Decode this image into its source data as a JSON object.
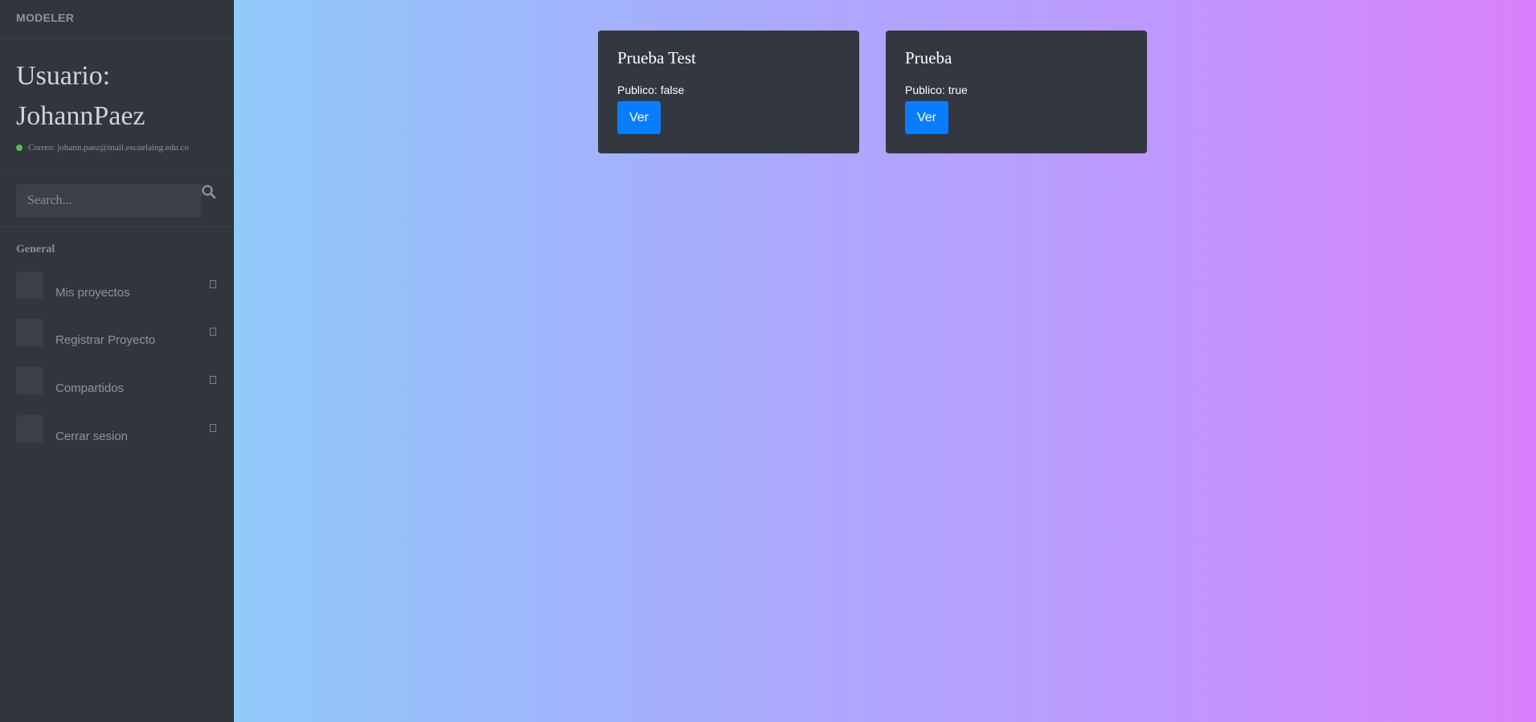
{
  "sidebar": {
    "brand": "MODELER",
    "user_title": "Usuario: JohannPaez",
    "email": "Correo: johann.paez@mail.escuelaing.edu.co",
    "search_placeholder": "Search...",
    "section_label": "General",
    "items": [
      {
        "label": "Mis proyectos"
      },
      {
        "label": "Registrar Proyecto"
      },
      {
        "label": "Compartidos"
      },
      {
        "label": "Cerrar sesion"
      }
    ]
  },
  "projects": [
    {
      "title": "Prueba Test",
      "meta": "Publico: false",
      "button": "Ver"
    },
    {
      "title": "Prueba",
      "meta": "Publico: true",
      "button": "Ver"
    }
  ],
  "colors": {
    "sidebar_bg": "#31353d",
    "card_bg": "#33373f",
    "accent": "#0a7cff",
    "status_online": "#5cb85c",
    "gradient_start": "#90caf9",
    "gradient_end": "#da80fc"
  },
  "icons": {
    "search": "search-icon",
    "status": "status-dot-icon",
    "menu_arrow": "chevron-icon"
  }
}
